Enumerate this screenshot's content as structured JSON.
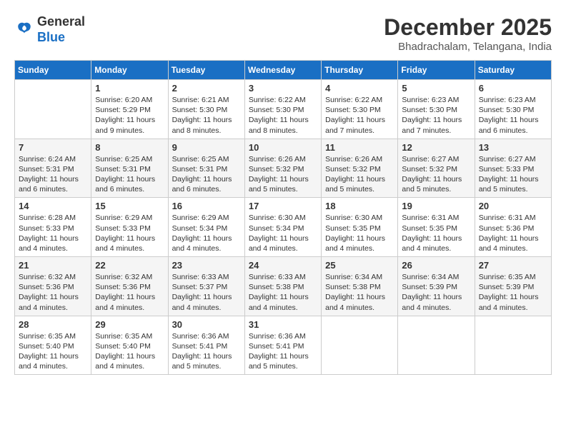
{
  "header": {
    "logo": {
      "general": "General",
      "blue": "Blue"
    },
    "title": "December 2025",
    "location": "Bhadrachalam, Telangana, India"
  },
  "days_of_week": [
    "Sunday",
    "Monday",
    "Tuesday",
    "Wednesday",
    "Thursday",
    "Friday",
    "Saturday"
  ],
  "weeks": [
    [
      {
        "day": "",
        "info": ""
      },
      {
        "day": "1",
        "info": "Sunrise: 6:20 AM\nSunset: 5:29 PM\nDaylight: 11 hours\nand 9 minutes."
      },
      {
        "day": "2",
        "info": "Sunrise: 6:21 AM\nSunset: 5:30 PM\nDaylight: 11 hours\nand 8 minutes."
      },
      {
        "day": "3",
        "info": "Sunrise: 6:22 AM\nSunset: 5:30 PM\nDaylight: 11 hours\nand 8 minutes."
      },
      {
        "day": "4",
        "info": "Sunrise: 6:22 AM\nSunset: 5:30 PM\nDaylight: 11 hours\nand 7 minutes."
      },
      {
        "day": "5",
        "info": "Sunrise: 6:23 AM\nSunset: 5:30 PM\nDaylight: 11 hours\nand 7 minutes."
      },
      {
        "day": "6",
        "info": "Sunrise: 6:23 AM\nSunset: 5:30 PM\nDaylight: 11 hours\nand 6 minutes."
      }
    ],
    [
      {
        "day": "7",
        "info": "Sunrise: 6:24 AM\nSunset: 5:31 PM\nDaylight: 11 hours\nand 6 minutes."
      },
      {
        "day": "8",
        "info": "Sunrise: 6:25 AM\nSunset: 5:31 PM\nDaylight: 11 hours\nand 6 minutes."
      },
      {
        "day": "9",
        "info": "Sunrise: 6:25 AM\nSunset: 5:31 PM\nDaylight: 11 hours\nand 6 minutes."
      },
      {
        "day": "10",
        "info": "Sunrise: 6:26 AM\nSunset: 5:32 PM\nDaylight: 11 hours\nand 5 minutes."
      },
      {
        "day": "11",
        "info": "Sunrise: 6:26 AM\nSunset: 5:32 PM\nDaylight: 11 hours\nand 5 minutes."
      },
      {
        "day": "12",
        "info": "Sunrise: 6:27 AM\nSunset: 5:32 PM\nDaylight: 11 hours\nand 5 minutes."
      },
      {
        "day": "13",
        "info": "Sunrise: 6:27 AM\nSunset: 5:33 PM\nDaylight: 11 hours\nand 5 minutes."
      }
    ],
    [
      {
        "day": "14",
        "info": "Sunrise: 6:28 AM\nSunset: 5:33 PM\nDaylight: 11 hours\nand 4 minutes."
      },
      {
        "day": "15",
        "info": "Sunrise: 6:29 AM\nSunset: 5:33 PM\nDaylight: 11 hours\nand 4 minutes."
      },
      {
        "day": "16",
        "info": "Sunrise: 6:29 AM\nSunset: 5:34 PM\nDaylight: 11 hours\nand 4 minutes."
      },
      {
        "day": "17",
        "info": "Sunrise: 6:30 AM\nSunset: 5:34 PM\nDaylight: 11 hours\nand 4 minutes."
      },
      {
        "day": "18",
        "info": "Sunrise: 6:30 AM\nSunset: 5:35 PM\nDaylight: 11 hours\nand 4 minutes."
      },
      {
        "day": "19",
        "info": "Sunrise: 6:31 AM\nSunset: 5:35 PM\nDaylight: 11 hours\nand 4 minutes."
      },
      {
        "day": "20",
        "info": "Sunrise: 6:31 AM\nSunset: 5:36 PM\nDaylight: 11 hours\nand 4 minutes."
      }
    ],
    [
      {
        "day": "21",
        "info": "Sunrise: 6:32 AM\nSunset: 5:36 PM\nDaylight: 11 hours\nand 4 minutes."
      },
      {
        "day": "22",
        "info": "Sunrise: 6:32 AM\nSunset: 5:36 PM\nDaylight: 11 hours\nand 4 minutes."
      },
      {
        "day": "23",
        "info": "Sunrise: 6:33 AM\nSunset: 5:37 PM\nDaylight: 11 hours\nand 4 minutes."
      },
      {
        "day": "24",
        "info": "Sunrise: 6:33 AM\nSunset: 5:38 PM\nDaylight: 11 hours\nand 4 minutes."
      },
      {
        "day": "25",
        "info": "Sunrise: 6:34 AM\nSunset: 5:38 PM\nDaylight: 11 hours\nand 4 minutes."
      },
      {
        "day": "26",
        "info": "Sunrise: 6:34 AM\nSunset: 5:39 PM\nDaylight: 11 hours\nand 4 minutes."
      },
      {
        "day": "27",
        "info": "Sunrise: 6:35 AM\nSunset: 5:39 PM\nDaylight: 11 hours\nand 4 minutes."
      }
    ],
    [
      {
        "day": "28",
        "info": "Sunrise: 6:35 AM\nSunset: 5:40 PM\nDaylight: 11 hours\nand 4 minutes."
      },
      {
        "day": "29",
        "info": "Sunrise: 6:35 AM\nSunset: 5:40 PM\nDaylight: 11 hours\nand 4 minutes."
      },
      {
        "day": "30",
        "info": "Sunrise: 6:36 AM\nSunset: 5:41 PM\nDaylight: 11 hours\nand 5 minutes."
      },
      {
        "day": "31",
        "info": "Sunrise: 6:36 AM\nSunset: 5:41 PM\nDaylight: 11 hours\nand 5 minutes."
      },
      {
        "day": "",
        "info": ""
      },
      {
        "day": "",
        "info": ""
      },
      {
        "day": "",
        "info": ""
      }
    ]
  ]
}
